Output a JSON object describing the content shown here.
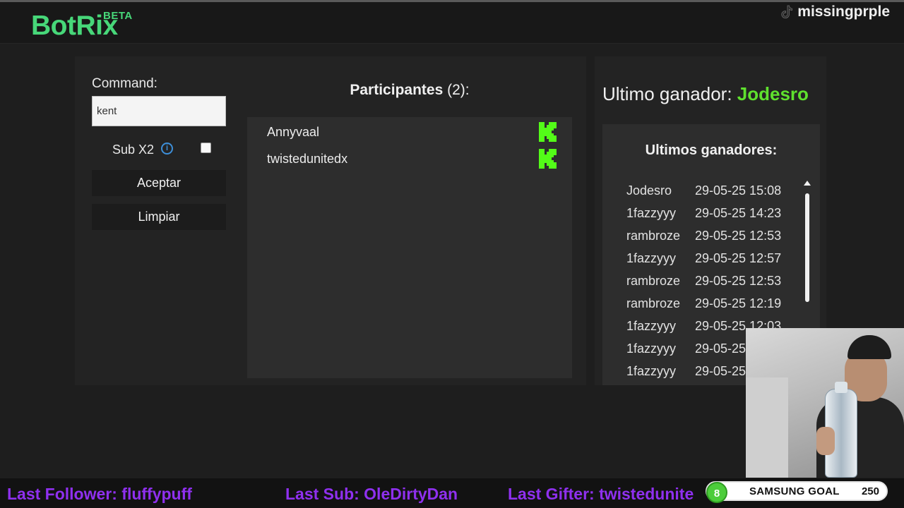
{
  "header": {
    "logo": "BotRix",
    "beta": "BETA",
    "channel": "missingprple"
  },
  "form": {
    "command_label": "Command:",
    "command_value": "kent",
    "sub_label": "Sub X2",
    "sub_checked": false,
    "accept_label": "Aceptar",
    "clear_label": "Limpiar"
  },
  "participants": {
    "title": "Participantes",
    "count": "(2):",
    "items": [
      {
        "name": "Annyvaal",
        "icon": "kick-icon"
      },
      {
        "name": "twistedunitedx",
        "icon": "kick-icon"
      }
    ]
  },
  "winners": {
    "last_label": "Ultimo ganador:",
    "last_name": "Jodesro",
    "list_title": "Ultimos ganadores:",
    "items": [
      {
        "name": "Jodesro",
        "time": "29-05-25 15:08"
      },
      {
        "name": "1fazzyyy",
        "time": "29-05-25 14:23"
      },
      {
        "name": "rambroze",
        "time": "29-05-25 12:53"
      },
      {
        "name": "1fazzyyy",
        "time": "29-05-25 12:57"
      },
      {
        "name": "rambroze",
        "time": "29-05-25 12:53"
      },
      {
        "name": "rambroze",
        "time": "29-05-25 12:19"
      },
      {
        "name": "1fazzyyy",
        "time": "29-05-25 12:03"
      },
      {
        "name": "1fazzyyy",
        "time": "29-05-25"
      },
      {
        "name": "1fazzyyy",
        "time": "29-05-25"
      }
    ]
  },
  "ticker": {
    "follower": "Last Follower: fluffypuff",
    "sub": "Last Sub: OleDirtyDan",
    "gifter": "Last Gifter: twistedunite"
  },
  "goal": {
    "count": "8",
    "label": "SAMSUNG GOAL",
    "target": "250"
  },
  "colors": {
    "accent_green": "#47d779",
    "winner_green": "#5fe02e",
    "kick_green": "#53fc18",
    "ticker_purple": "#8f30ef",
    "info_blue": "#3d8fd9"
  }
}
